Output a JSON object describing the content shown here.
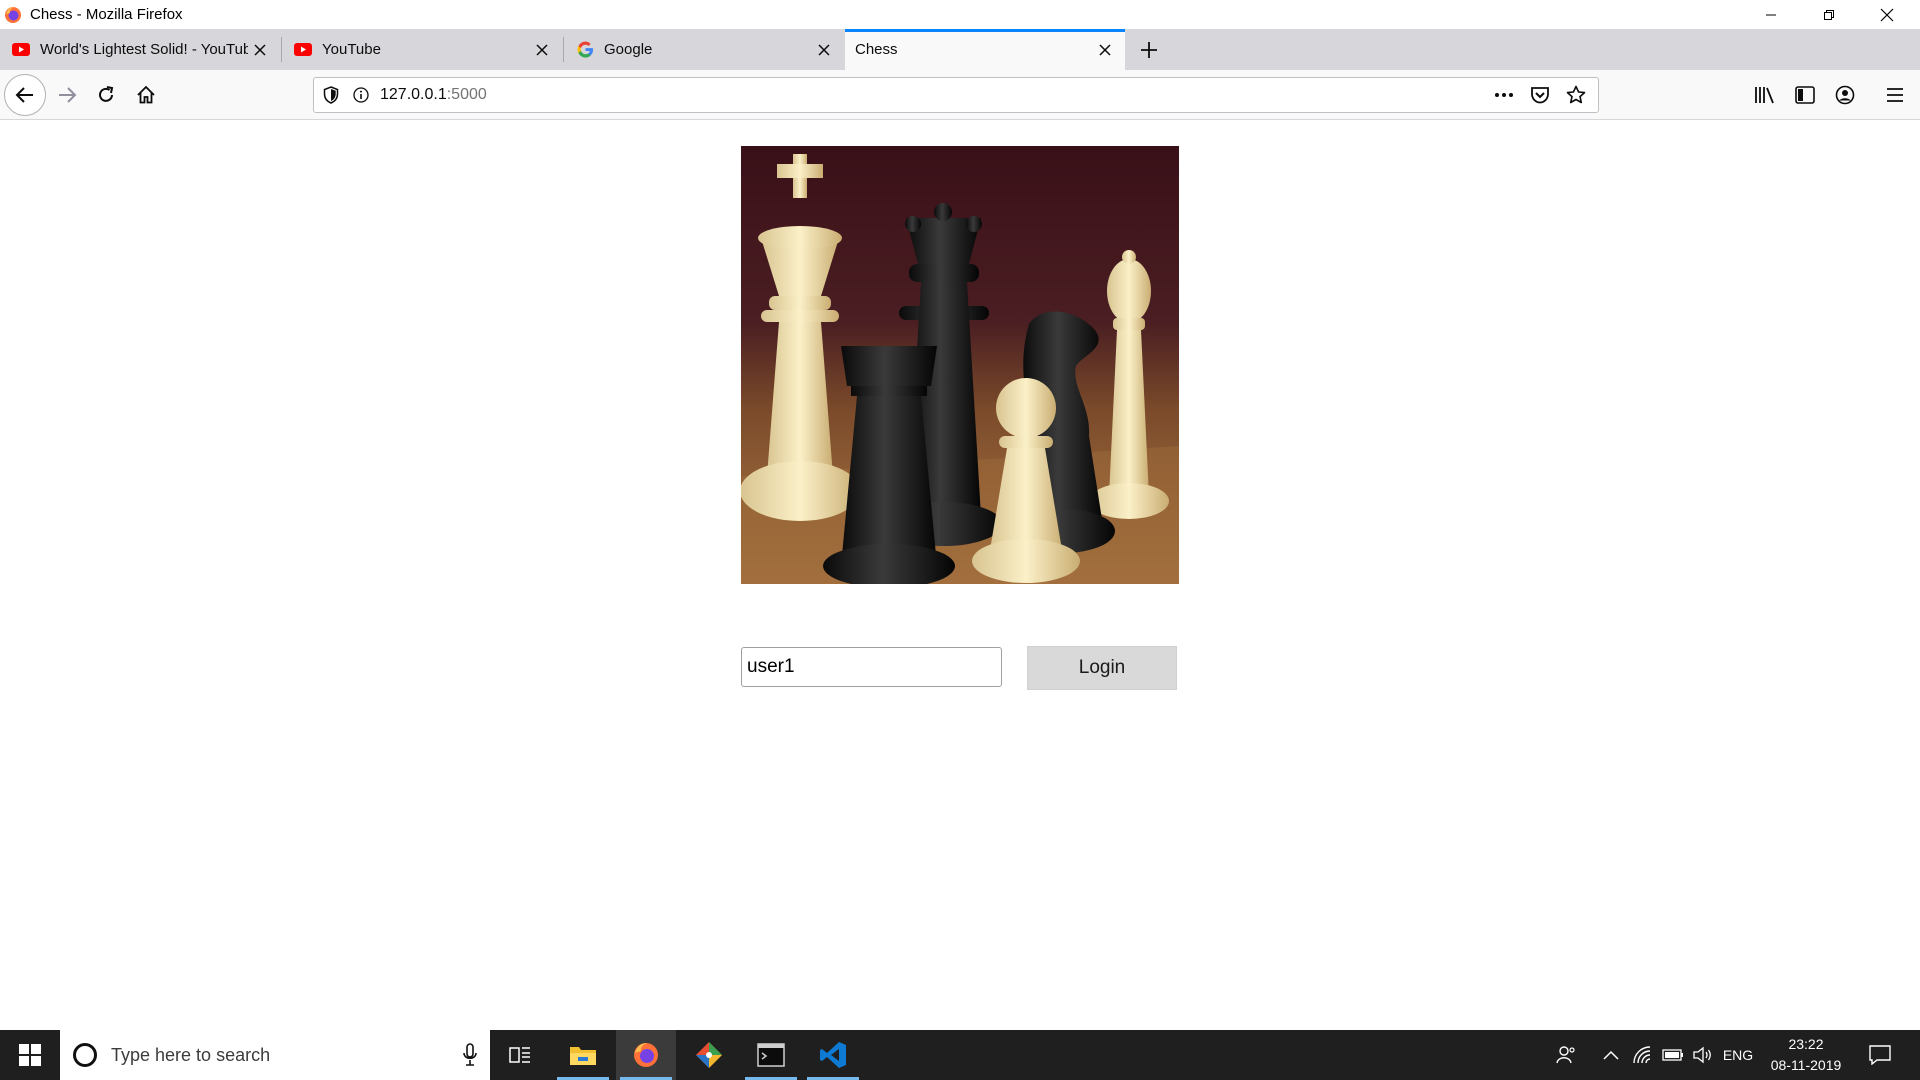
{
  "window": {
    "title": "Chess - Mozilla Firefox"
  },
  "tabs": [
    {
      "label": "World's Lightest Solid! - YouTube",
      "favicon": "youtube-icon",
      "active": false
    },
    {
      "label": "YouTube",
      "favicon": "youtube-icon",
      "active": false
    },
    {
      "label": "Google",
      "favicon": "google-icon",
      "active": false
    },
    {
      "label": "Chess",
      "favicon": "none",
      "active": true
    }
  ],
  "navbar": {
    "url_host": "127.0.0.1",
    "url_port": ":5000"
  },
  "page": {
    "image_alt": "chess-pieces-photo",
    "username_value": "user1",
    "login_label": "Login"
  },
  "taskbar": {
    "search_placeholder": "Type here to search",
    "apps": [
      "task-view",
      "file-explorer",
      "firefox",
      "git",
      "terminal",
      "vscode"
    ],
    "language": "ENG",
    "time": "23:22",
    "date": "08-11-2019"
  },
  "colors": {
    "accent": "#0a84ff",
    "tabstrip": "#d7d7db",
    "taskbar": "#1f1f1f",
    "button": "#d9d9d9"
  }
}
